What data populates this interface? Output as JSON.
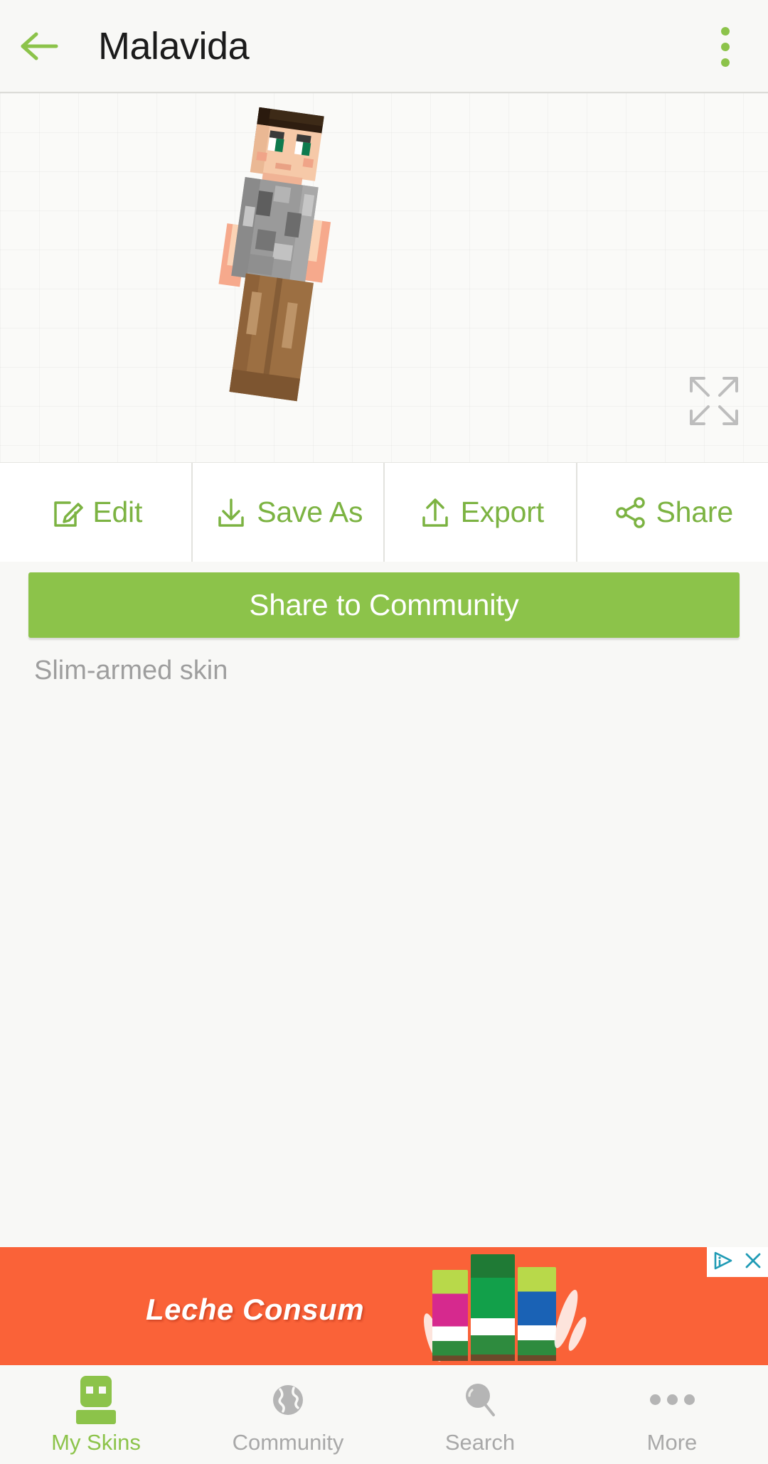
{
  "header": {
    "title": "Malavida",
    "back_icon": "arrow-left-icon",
    "overflow_icon": "more-vertical-icon",
    "accent_color": "#8cc34a"
  },
  "preview": {
    "fullscreen_icon": "fullscreen-expand-icon",
    "skin_model": {
      "hair_color": "#2e1d10",
      "skin_color": "#f6c9a8",
      "eye_color": "#0d7a4e",
      "shirt_color": "#9a9a9a",
      "pants_color": "#9c6f42"
    }
  },
  "actions": [
    {
      "label": "Edit",
      "icon": "edit-pencil-icon"
    },
    {
      "label": "Save As",
      "icon": "download-icon"
    },
    {
      "label": "Export",
      "icon": "upload-icon"
    },
    {
      "label": "Share",
      "icon": "share-nodes-icon"
    }
  ],
  "primary_button": {
    "label": "Share to Community",
    "color": "#8cc34a",
    "text_color": "#ffffff"
  },
  "skin_caption": "Slim-armed skin",
  "ad": {
    "text": "Leche Consum",
    "background_color": "#fa6238",
    "adchoices_icon": "adchoices-icon",
    "close_icon": "close-x-icon"
  },
  "bottom_nav": {
    "items": [
      {
        "label": "My Skins",
        "icon": "skin-avatar-icon",
        "active": true
      },
      {
        "label": "Community",
        "icon": "globe-icon",
        "active": false
      },
      {
        "label": "Search",
        "icon": "magnifier-icon",
        "active": false
      },
      {
        "label": "More",
        "icon": "ellipsis-icon",
        "active": false
      }
    ],
    "active_color": "#8cc34a",
    "inactive_color": "#a8a8a8"
  }
}
